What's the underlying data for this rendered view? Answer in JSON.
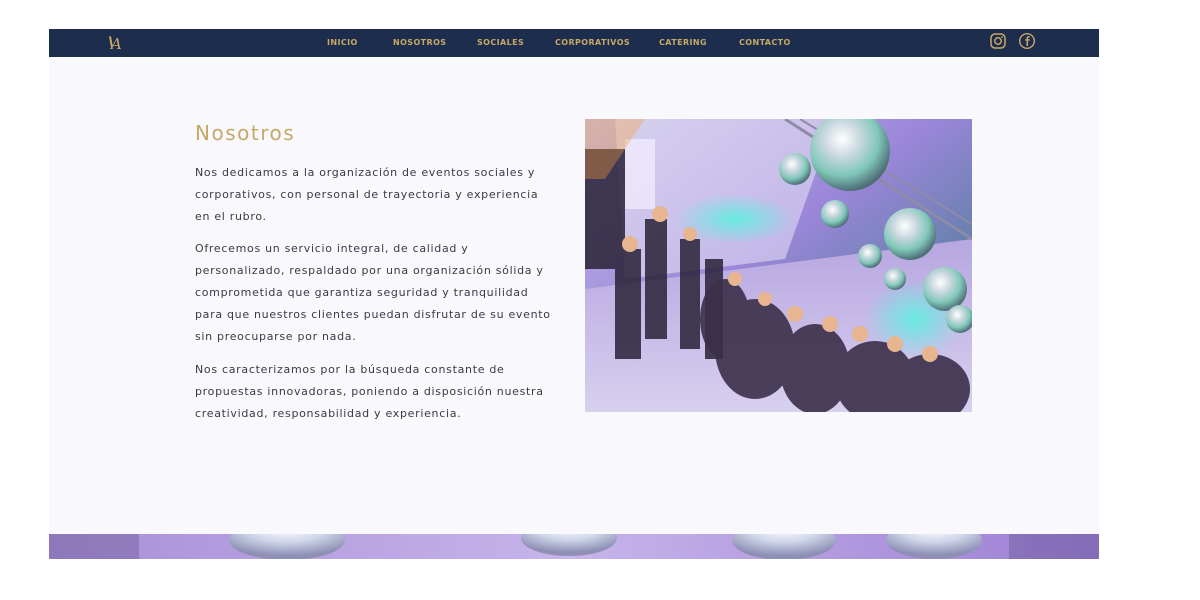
{
  "nav": {
    "items": [
      {
        "label": "INICIO"
      },
      {
        "label": "NOSOTROS"
      },
      {
        "label": "SOCIALES"
      },
      {
        "label": "CORPORATIVOS"
      },
      {
        "label": "CATERING"
      },
      {
        "label": "CONTACTO"
      }
    ],
    "logo_letter": "A",
    "social": [
      "instagram-icon",
      "facebook-icon"
    ]
  },
  "about": {
    "title": "Nosotros",
    "paragraphs": [
      "Nos dedicamos a la organización de eventos sociales y corporativos, con personal de trayectoria y experiencia en el rubro.",
      "Ofrecemos un servicio integral, de calidad y personalizado, respaldado por una organización sólida y comprometida que garantiza seguridad y tranquilidad para que nuestros clientes puedan disfrutar de su evento sin preocuparse por nada.",
      "Nos caracterizamos por la búsqueda constante de propuestas innovadoras, poniendo a disposición nuestra creatividad, responsabilidad y experiencia."
    ]
  },
  "colors": {
    "navy": "#1d2d4e",
    "gold": "#c8a865",
    "background": "#f8f8fd",
    "text": "#3a3a48"
  }
}
